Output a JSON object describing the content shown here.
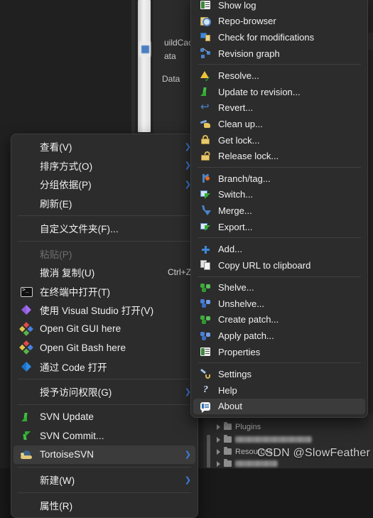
{
  "background": {
    "file_labels": [
      "uildCac",
      "ata",
      "Data"
    ],
    "tree_items": [
      {
        "label": "Plugins",
        "blurred": false
      },
      {
        "label": "",
        "blurred": true
      },
      {
        "label": "Resources",
        "blurred": false
      },
      {
        "label": "",
        "blurred": true
      }
    ],
    "watermark": "CSDN @SlowFeather"
  },
  "colors": {
    "menu_bg": "#2c2c2c",
    "menu_border": "#3d3d3d",
    "menu_text": "#f1f1f1",
    "menu_disabled_text": "#6f6f6f",
    "menu_separator": "#3f3f3f",
    "highlight_bg": "#3b3b3b",
    "submenu_arrow": "#3d7ddd",
    "desktop_bg": "#1a1a1a"
  },
  "context_menu": {
    "name": "explorer-context-menu",
    "items": [
      {
        "type": "item",
        "icon": "none",
        "label": "查看(V)",
        "accel": "",
        "arrow": true,
        "disabled": false,
        "selected": false
      },
      {
        "type": "item",
        "icon": "none",
        "label": "排序方式(O)",
        "accel": "",
        "arrow": true,
        "disabled": false,
        "selected": false
      },
      {
        "type": "item",
        "icon": "none",
        "label": "分组依据(P)",
        "accel": "",
        "arrow": true,
        "disabled": false,
        "selected": false
      },
      {
        "type": "item",
        "icon": "none",
        "label": "刷新(E)",
        "accel": "",
        "arrow": false,
        "disabled": false,
        "selected": false
      },
      {
        "type": "separator"
      },
      {
        "type": "item",
        "icon": "none",
        "label": "自定义文件夹(F)...",
        "accel": "",
        "arrow": false,
        "disabled": false,
        "selected": false
      },
      {
        "type": "separator"
      },
      {
        "type": "item",
        "icon": "none",
        "label": "粘贴(P)",
        "accel": "",
        "arrow": false,
        "disabled": true,
        "selected": false
      },
      {
        "type": "item",
        "icon": "none",
        "label": "撤消 复制(U)",
        "accel": "Ctrl+Z",
        "arrow": false,
        "disabled": false,
        "selected": false
      },
      {
        "type": "item",
        "icon": "terminal-icon",
        "label": "在终端中打开(T)",
        "accel": "",
        "arrow": false,
        "disabled": false,
        "selected": false
      },
      {
        "type": "item",
        "icon": "visual-studio-icon",
        "label": "使用 Visual Studio 打开(V)",
        "accel": "",
        "arrow": false,
        "disabled": false,
        "selected": false
      },
      {
        "type": "item",
        "icon": "git-icon",
        "label": "Open Git GUI here",
        "accel": "",
        "arrow": false,
        "disabled": false,
        "selected": false
      },
      {
        "type": "item",
        "icon": "git-icon",
        "label": "Open Git Bash here",
        "accel": "",
        "arrow": false,
        "disabled": false,
        "selected": false
      },
      {
        "type": "item",
        "icon": "vscode-icon",
        "label": "通过 Code 打开",
        "accel": "",
        "arrow": false,
        "disabled": false,
        "selected": false
      },
      {
        "type": "separator"
      },
      {
        "type": "item",
        "icon": "none",
        "label": "授予访问权限(G)",
        "accel": "",
        "arrow": true,
        "disabled": false,
        "selected": false
      },
      {
        "type": "separator"
      },
      {
        "type": "item",
        "icon": "svn-update-icon",
        "label": "SVN Update",
        "accel": "",
        "arrow": false,
        "disabled": false,
        "selected": false
      },
      {
        "type": "item",
        "icon": "svn-commit-icon",
        "label": "SVN Commit...",
        "accel": "",
        "arrow": false,
        "disabled": false,
        "selected": false
      },
      {
        "type": "item",
        "icon": "tortoise-icon",
        "label": "TortoiseSVN",
        "accel": "",
        "arrow": true,
        "disabled": false,
        "selected": true
      },
      {
        "type": "separator"
      },
      {
        "type": "item",
        "icon": "none",
        "label": "新建(W)",
        "accel": "",
        "arrow": true,
        "disabled": false,
        "selected": false
      },
      {
        "type": "separator"
      },
      {
        "type": "item",
        "icon": "none",
        "label": "属性(R)",
        "accel": "",
        "arrow": false,
        "disabled": false,
        "selected": false
      }
    ]
  },
  "submenu": {
    "name": "tortoisesvn-submenu",
    "items": [
      {
        "type": "item",
        "icon": "show-log-icon",
        "label": "Show log",
        "selected": false
      },
      {
        "type": "item",
        "icon": "repo-browser-icon",
        "label": "Repo-browser",
        "selected": false
      },
      {
        "type": "item",
        "icon": "check-modifications-icon",
        "label": "Check for modifications",
        "selected": false
      },
      {
        "type": "item",
        "icon": "revision-graph-icon",
        "label": "Revision graph",
        "selected": false
      },
      {
        "type": "separator"
      },
      {
        "type": "item",
        "icon": "resolve-icon",
        "label": "Resolve...",
        "selected": false
      },
      {
        "type": "item",
        "icon": "update-to-revision-icon",
        "label": "Update to revision...",
        "selected": false
      },
      {
        "type": "item",
        "icon": "revert-icon",
        "label": "Revert...",
        "selected": false
      },
      {
        "type": "item",
        "icon": "clean-up-icon",
        "label": "Clean up...",
        "selected": false
      },
      {
        "type": "item",
        "icon": "get-lock-icon",
        "label": "Get lock...",
        "selected": false
      },
      {
        "type": "item",
        "icon": "release-lock-icon",
        "label": "Release lock...",
        "selected": false
      },
      {
        "type": "separator"
      },
      {
        "type": "item",
        "icon": "branch-tag-icon",
        "label": "Branch/tag...",
        "selected": false
      },
      {
        "type": "item",
        "icon": "switch-icon",
        "label": "Switch...",
        "selected": false
      },
      {
        "type": "item",
        "icon": "merge-icon",
        "label": "Merge...",
        "selected": false
      },
      {
        "type": "item",
        "icon": "export-icon",
        "label": "Export...",
        "selected": false
      },
      {
        "type": "separator"
      },
      {
        "type": "item",
        "icon": "add-icon",
        "label": "Add...",
        "selected": false
      },
      {
        "type": "item",
        "icon": "copy-url-icon",
        "label": "Copy URL to clipboard",
        "selected": false
      },
      {
        "type": "separator"
      },
      {
        "type": "item",
        "icon": "shelve-icon",
        "label": "Shelve...",
        "selected": false
      },
      {
        "type": "item",
        "icon": "unshelve-icon",
        "label": "Unshelve...",
        "selected": false
      },
      {
        "type": "item",
        "icon": "create-patch-icon",
        "label": "Create patch...",
        "selected": false
      },
      {
        "type": "item",
        "icon": "apply-patch-icon",
        "label": "Apply patch...",
        "selected": false
      },
      {
        "type": "item",
        "icon": "properties-icon",
        "label": "Properties",
        "selected": false
      },
      {
        "type": "separator"
      },
      {
        "type": "item",
        "icon": "settings-icon",
        "label": "Settings",
        "selected": false
      },
      {
        "type": "item",
        "icon": "help-icon",
        "label": "Help",
        "selected": false
      },
      {
        "type": "item",
        "icon": "about-icon",
        "label": "About",
        "selected": true
      }
    ]
  }
}
